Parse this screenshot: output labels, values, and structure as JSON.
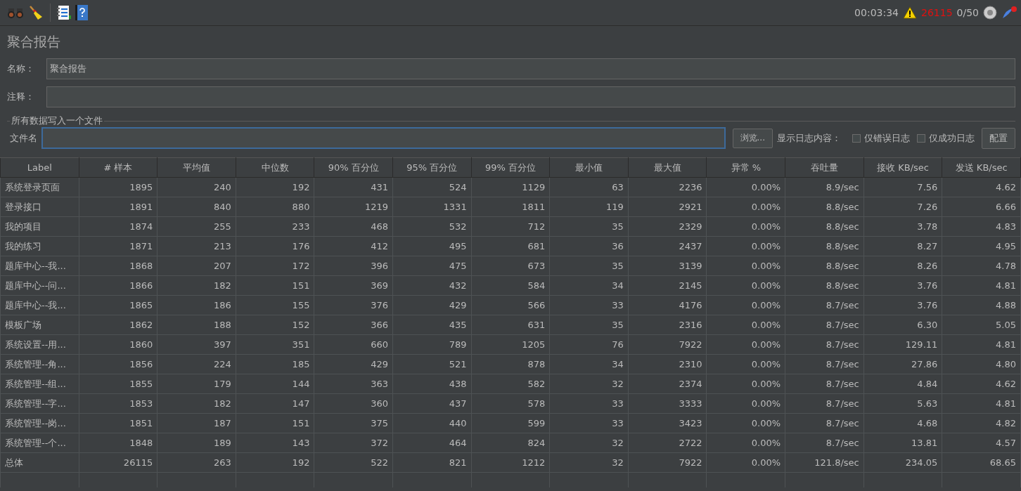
{
  "toolbar": {
    "elapsed": "00:03:34",
    "error_count": "26115",
    "threads": "0/50"
  },
  "panel": {
    "title": "聚合报告",
    "name_label": "名称：",
    "name_value": "聚合报告",
    "comment_label": "注释：",
    "file_group": "所有数据写入一个文件",
    "file_label": "文件名",
    "browse": "浏览...",
    "log_label": "显示日志内容：",
    "checkboxes": [
      {
        "label": "仅错误日志",
        "checked": false
      },
      {
        "label": "仅成功日志",
        "checked": false
      }
    ],
    "config": "配置"
  },
  "table": {
    "columns": [
      "Label",
      "# 样本",
      "平均值",
      "中位数",
      "90% 百分位",
      "95% 百分位",
      "99% 百分位",
      "最小值",
      "最大值",
      "异常 %",
      "吞吐量",
      "接收 KB/sec",
      "发送 KB/sec"
    ],
    "rows": [
      [
        "系统登录页面",
        "1895",
        "240",
        "192",
        "431",
        "524",
        "1129",
        "63",
        "2236",
        "0.00%",
        "8.9/sec",
        "7.56",
        "4.62"
      ],
      [
        "登录接口",
        "1891",
        "840",
        "880",
        "1219",
        "1331",
        "1811",
        "119",
        "2921",
        "0.00%",
        "8.8/sec",
        "7.26",
        "6.66"
      ],
      [
        "我的项目",
        "1874",
        "255",
        "233",
        "468",
        "532",
        "712",
        "35",
        "2329",
        "0.00%",
        "8.8/sec",
        "3.78",
        "4.83"
      ],
      [
        "我的练习",
        "1871",
        "213",
        "176",
        "412",
        "495",
        "681",
        "36",
        "2437",
        "0.00%",
        "8.8/sec",
        "8.27",
        "4.95"
      ],
      [
        "题库中心--我...",
        "1868",
        "207",
        "172",
        "396",
        "475",
        "673",
        "35",
        "3139",
        "0.00%",
        "8.8/sec",
        "8.26",
        "4.78"
      ],
      [
        "题库中心--问...",
        "1866",
        "182",
        "151",
        "369",
        "432",
        "584",
        "34",
        "2145",
        "0.00%",
        "8.8/sec",
        "3.76",
        "4.81"
      ],
      [
        "题库中心--我...",
        "1865",
        "186",
        "155",
        "376",
        "429",
        "566",
        "33",
        "4176",
        "0.00%",
        "8.7/sec",
        "3.76",
        "4.88"
      ],
      [
        "模板广场",
        "1862",
        "188",
        "152",
        "366",
        "435",
        "631",
        "35",
        "2316",
        "0.00%",
        "8.7/sec",
        "6.30",
        "5.05"
      ],
      [
        "系统设置--用...",
        "1860",
        "397",
        "351",
        "660",
        "789",
        "1205",
        "76",
        "7922",
        "0.00%",
        "8.7/sec",
        "129.11",
        "4.81"
      ],
      [
        "系统管理--角...",
        "1856",
        "224",
        "185",
        "429",
        "521",
        "878",
        "34",
        "2310",
        "0.00%",
        "8.7/sec",
        "27.86",
        "4.80"
      ],
      [
        "系统管理--组...",
        "1855",
        "179",
        "144",
        "363",
        "438",
        "582",
        "32",
        "2374",
        "0.00%",
        "8.7/sec",
        "4.84",
        "4.62"
      ],
      [
        "系统管理--字...",
        "1853",
        "182",
        "147",
        "360",
        "437",
        "578",
        "33",
        "3333",
        "0.00%",
        "8.7/sec",
        "5.63",
        "4.81"
      ],
      [
        "系统管理--岗...",
        "1851",
        "187",
        "151",
        "375",
        "440",
        "599",
        "33",
        "3423",
        "0.00%",
        "8.7/sec",
        "4.68",
        "4.82"
      ],
      [
        "系统管理--个...",
        "1848",
        "189",
        "143",
        "372",
        "464",
        "824",
        "32",
        "2722",
        "0.00%",
        "8.7/sec",
        "13.81",
        "4.57"
      ],
      [
        "总体",
        "26115",
        "263",
        "192",
        "522",
        "821",
        "1212",
        "32",
        "7922",
        "0.00%",
        "121.8/sec",
        "234.05",
        "68.65"
      ]
    ]
  }
}
